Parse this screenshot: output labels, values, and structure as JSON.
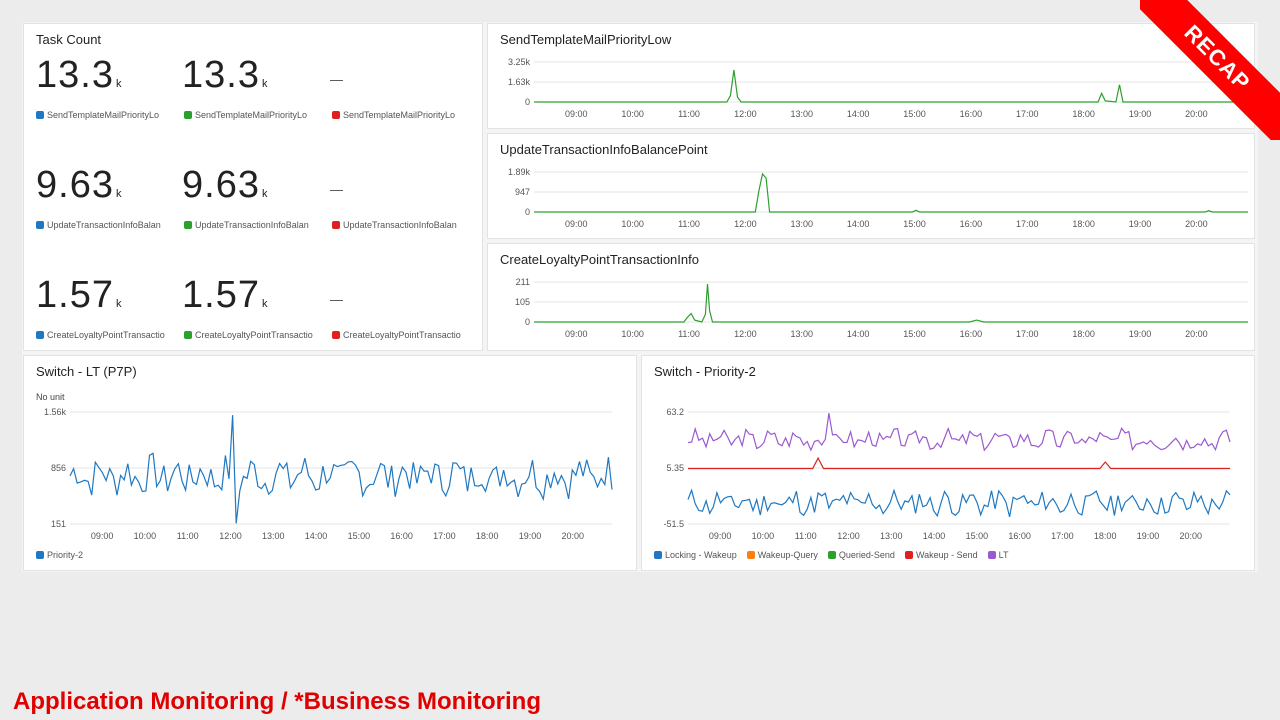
{
  "footer": {
    "title": "Application Monitoring / *Business Monitoring"
  },
  "banner": {
    "label": "RECAP"
  },
  "colors": {
    "blue": "#1f78c1",
    "green": "#2ca02c",
    "red": "#e02020",
    "orange": "#ff7f0e",
    "purple": "#9b59d0"
  },
  "task_count": {
    "title": "Task Count",
    "rows": [
      {
        "v1": "13.3",
        "v2": "13.3",
        "unit": "k",
        "dash": "—",
        "legends": [
          "SendTemplateMailPriorityLo",
          "SendTemplateMailPriorityLo",
          "SendTemplateMailPriorityLo"
        ]
      },
      {
        "v1": "9.63",
        "v2": "9.63",
        "unit": "k",
        "dash": "—",
        "legends": [
          "UpdateTransactionInfoBalan",
          "UpdateTransactionInfoBalan",
          "UpdateTransactionInfoBalan"
        ]
      },
      {
        "v1": "1.57",
        "v2": "1.57",
        "unit": "k",
        "dash": "—",
        "legends": [
          "CreateLoyaltyPointTransactio",
          "CreateLoyaltyPointTransactio",
          "CreateLoyaltyPointTransactio"
        ]
      }
    ]
  },
  "time_ticks": [
    "09:00",
    "10:00",
    "11:00",
    "12:00",
    "13:00",
    "14:00",
    "15:00",
    "16:00",
    "17:00",
    "18:00",
    "19:00",
    "20:00"
  ],
  "chart_data": [
    {
      "type": "line",
      "title": "SendTemplateMailPriorityLow",
      "color": "green",
      "y_ticks": [
        "3.25k",
        "1.63k",
        "0"
      ],
      "ylim": [
        0,
        3250
      ],
      "x_range": [
        "08:15",
        "20:55"
      ],
      "series": [
        {
          "values": [
            [
              0,
              0
            ],
            [
              0.27,
              0
            ],
            [
              0.275,
              500
            ],
            [
              0.28,
              2600
            ],
            [
              0.285,
              400
            ],
            [
              0.29,
              0
            ],
            [
              0.79,
              0
            ],
            [
              0.795,
              700
            ],
            [
              0.8,
              100
            ],
            [
              0.815,
              0
            ],
            [
              0.82,
              1400
            ],
            [
              0.825,
              0
            ],
            [
              1,
              0
            ]
          ]
        }
      ]
    },
    {
      "type": "line",
      "title": "UpdateTransactionInfoBalancePoint",
      "color": "green",
      "y_ticks": [
        "1.89k",
        "947",
        "0"
      ],
      "ylim": [
        0,
        1890
      ],
      "x_range": [
        "08:15",
        "20:55"
      ],
      "series": [
        {
          "values": [
            [
              0,
              0
            ],
            [
              0.31,
              0
            ],
            [
              0.315,
              1000
            ],
            [
              0.32,
              1800
            ],
            [
              0.325,
              1600
            ],
            [
              0.33,
              0
            ],
            [
              0.53,
              0
            ],
            [
              0.535,
              80
            ],
            [
              0.54,
              0
            ],
            [
              0.94,
              0
            ],
            [
              0.945,
              60
            ],
            [
              0.95,
              0
            ],
            [
              1,
              0
            ]
          ]
        }
      ]
    },
    {
      "type": "line",
      "title": "CreateLoyaltyPointTransactionInfo",
      "color": "green",
      "y_ticks": [
        "211",
        "105",
        "0"
      ],
      "ylim": [
        0,
        211
      ],
      "x_range": [
        "08:15",
        "20:55"
      ],
      "series": [
        {
          "values": [
            [
              0,
              0
            ],
            [
              0.21,
              0
            ],
            [
              0.215,
              25
            ],
            [
              0.22,
              45
            ],
            [
              0.225,
              10
            ],
            [
              0.235,
              0
            ],
            [
              0.24,
              40
            ],
            [
              0.243,
              200
            ],
            [
              0.246,
              60
            ],
            [
              0.25,
              0
            ],
            [
              0.61,
              0
            ],
            [
              0.62,
              10
            ],
            [
              0.63,
              0
            ],
            [
              1,
              0
            ]
          ]
        }
      ]
    },
    {
      "type": "line",
      "title": "Switch - LT (P7P)",
      "color": "blue",
      "y_label": "No unit",
      "y_ticks": [
        "1.56k",
        "856",
        "151"
      ],
      "ylim": [
        151,
        1560
      ],
      "x_range": [
        "08:15",
        "20:55"
      ],
      "series": [
        {
          "name": "Priority-2",
          "seed": 7,
          "base": 760,
          "amp": 220,
          "spikes": [
            [
              0.3,
              1520
            ],
            [
              0.3,
              160
            ]
          ]
        }
      ]
    },
    {
      "type": "line",
      "title": "Switch - Priority-2",
      "color": "purple",
      "y_ticks": [
        "63.2",
        "5.35",
        "-51.5"
      ],
      "ylim": [
        -51.5,
        63.2
      ],
      "x_range": [
        "08:15",
        "20:55"
      ],
      "series": [
        {
          "name": "Locking - Wakeup",
          "color": "blue",
          "seed": 11,
          "base": -30,
          "amp": 12
        },
        {
          "name": "Wakeup-Query",
          "color": "orange",
          "flat": 0,
          "hidden_under": true
        },
        {
          "name": "Queried-Send",
          "color": "green",
          "flat": 0,
          "hidden_under": true
        },
        {
          "name": "Wakeup - Send",
          "color": "red",
          "flat": 5.35,
          "bumps": [
            [
              0.24,
              16
            ],
            [
              0.77,
              12
            ]
          ]
        },
        {
          "name": "LT",
          "color": "purple",
          "seed": 3,
          "base": 35,
          "amp": 9,
          "spikes": [
            [
              0.26,
              62
            ]
          ]
        }
      ]
    }
  ]
}
